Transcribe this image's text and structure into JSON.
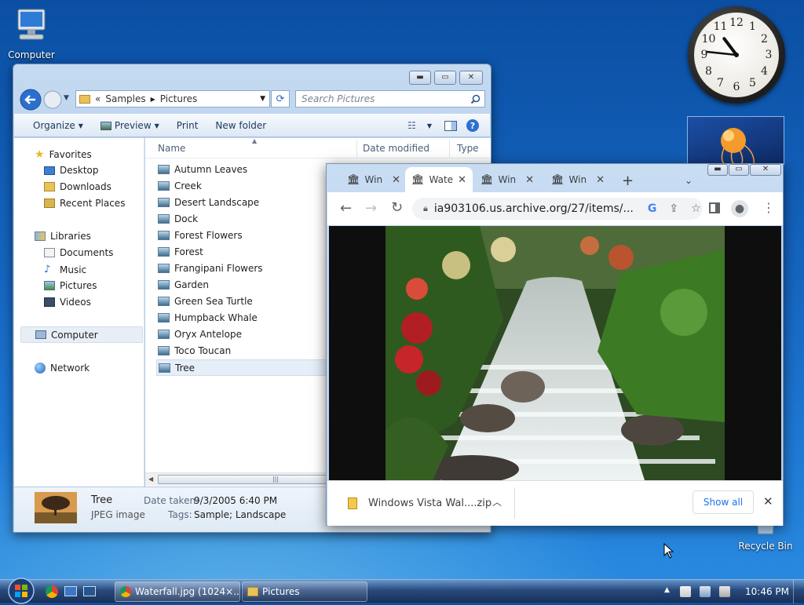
{
  "desktop": {
    "computer_label": "Computer",
    "recycle_label": "Recycle Bin"
  },
  "clock": {
    "numbers": [
      "12",
      "1",
      "2",
      "3",
      "4",
      "5",
      "6",
      "7",
      "8",
      "9",
      "10",
      "11"
    ],
    "time": "10:46"
  },
  "explorer": {
    "breadcrumb_prefix": "«",
    "breadcrumb": [
      "Samples",
      "Pictures"
    ],
    "search_placeholder": "Search Pictures",
    "toolbar": {
      "organize": "Organize",
      "preview": "Preview",
      "print": "Print",
      "new_folder": "New folder"
    },
    "nav": {
      "favorites": "Favorites",
      "desktop": "Desktop",
      "downloads": "Downloads",
      "recent": "Recent Places",
      "libraries": "Libraries",
      "documents": "Documents",
      "music": "Music",
      "pictures": "Pictures",
      "videos": "Videos",
      "computer": "Computer",
      "network": "Network"
    },
    "columns": {
      "name": "Name",
      "date": "Date modified",
      "type": "Type"
    },
    "files": [
      "Autumn Leaves",
      "Creek",
      "Desert Landscape",
      "Dock",
      "Forest Flowers",
      "Forest",
      "Frangipani Flowers",
      "Garden",
      "Green Sea Turtle",
      "Humpback Whale",
      "Oryx Antelope",
      "Toco Toucan",
      "Tree"
    ],
    "selected_file": "Tree",
    "details": {
      "name": "Tree",
      "type": "JPEG image",
      "date_label": "Date taken:",
      "date_value": "9/3/2005 6:40 PM",
      "tags_label": "Tags:",
      "tags_value": "Sample; Landscape"
    }
  },
  "chrome": {
    "tabs": [
      {
        "title": "Win",
        "active": false
      },
      {
        "title": "Wate",
        "active": true
      },
      {
        "title": "Win",
        "active": false
      },
      {
        "title": "Win",
        "active": false
      }
    ],
    "url": "ia903106.us.archive.org/27/items/...",
    "download_name": "Windows Vista Wal....zip",
    "show_all": "Show all"
  },
  "taskbar": {
    "tasks": [
      {
        "label": "Waterfall.jpg (1024×...",
        "app": "chrome"
      },
      {
        "label": "Pictures",
        "app": "explorer"
      }
    ],
    "time": "10:46 PM"
  },
  "colors": {
    "accent": "#1f6fd1",
    "selection": "#e5eef9"
  }
}
